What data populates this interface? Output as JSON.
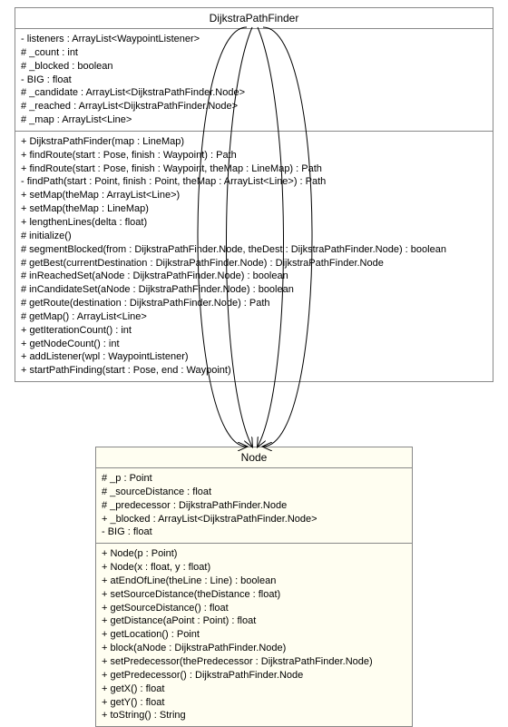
{
  "classes": {
    "dijkstra": {
      "name": "DijkstraPathFinder",
      "attributes": [
        "- listeners : ArrayList<WaypointListener>",
        "# _count : int",
        "# _blocked : boolean",
        "- BIG : float",
        "# _candidate : ArrayList<DijkstraPathFinder.Node>",
        "# _reached : ArrayList<DijkstraPathFinder.Node>",
        "# _map : ArrayList<Line>"
      ],
      "operations": [
        "+ DijkstraPathFinder(map : LineMap)",
        "+ findRoute(start : Pose, finish : Waypoint) : Path",
        "+ findRoute(start : Pose, finish : Waypoint, theMap : LineMap) : Path",
        "- findPath(start : Point, finish : Point, theMap : ArrayList<Line>) : Path",
        "+ setMap(theMap : ArrayList<Line>)",
        "+ setMap(theMap : LineMap)",
        "+ lengthenLines(delta : float)",
        "# initialize()",
        "# segmentBlocked(from : DijkstraPathFinder.Node, theDest : DijkstraPathFinder.Node) : boolean",
        "# getBest(currentDestination : DijkstraPathFinder.Node) : DijkstraPathFinder.Node",
        "# inReachedSet(aNode : DijkstraPathFinder.Node) : boolean",
        "# inCandidateSet(aNode : DijkstraPathFinder.Node) : boolean",
        "# getRoute(destination : DijkstraPathFinder.Node) : Path",
        "# getMap() : ArrayList<Line>",
        "+ getIterationCount() : int",
        "+ getNodeCount() : int",
        "+ addListener(wpl : WaypointListener)",
        "+ startPathFinding(start : Pose, end : Waypoint)"
      ]
    },
    "node": {
      "name": "Node",
      "attributes": [
        "# _p : Point",
        "# _sourceDistance : float",
        "# _predecessor : DijkstraPathFinder.Node",
        "+ _blocked : ArrayList<DijkstraPathFinder.Node>",
        "- BIG : float"
      ],
      "operations": [
        "+ Node(p : Point)",
        "+ Node(x : float, y : float)",
        "+ atEndOfLine(theLine : Line) : boolean",
        "+ setSourceDistance(theDistance : float)",
        "+ getSourceDistance() : float",
        "+ getDistance(aPoint : Point) : float",
        "+ getLocation() : Point",
        "+ block(aNode : DijkstraPathFinder.Node)",
        "+ setPredecessor(thePredecessor : DijkstraPathFinder.Node)",
        "+ getPredecessor() : DijkstraPathFinder.Node",
        "+ getX() : float",
        "+ getY() : float",
        "+ toString() : String"
      ]
    }
  }
}
